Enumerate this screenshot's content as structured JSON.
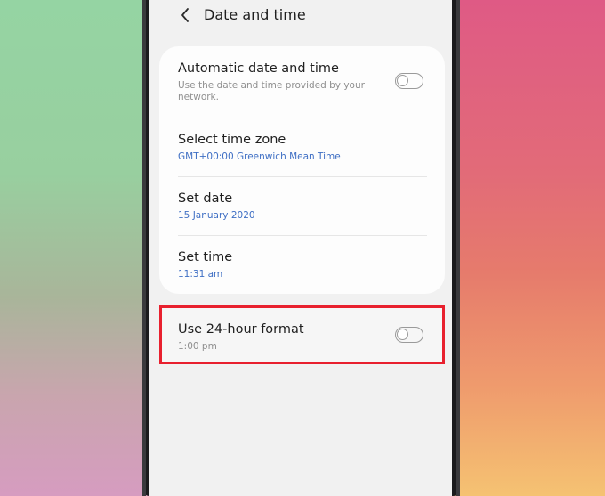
{
  "header": {
    "title": "Date and time"
  },
  "settings": {
    "automatic": {
      "title": "Automatic date and time",
      "subtitle_line1": "Use the date and time provided by your",
      "subtitle_line2": "network.",
      "enabled": false
    },
    "time_zone": {
      "title": "Select time zone",
      "value": "GMT+00:00 Greenwich Mean Time"
    },
    "date": {
      "title": "Set date",
      "value": "15 January 2020"
    },
    "time": {
      "title": "Set time",
      "value": "11:31 am"
    },
    "format_24h": {
      "title": "Use 24-hour format",
      "subtitle": "1:00 pm",
      "enabled": false
    }
  },
  "colors": {
    "accent_blue": "#3f6fc4",
    "highlight_red": "#e8202e",
    "toggle_off": "#9a9a9a"
  },
  "icons": {
    "back": "chevron-left-icon",
    "toggle": "toggle-switch-icon"
  }
}
